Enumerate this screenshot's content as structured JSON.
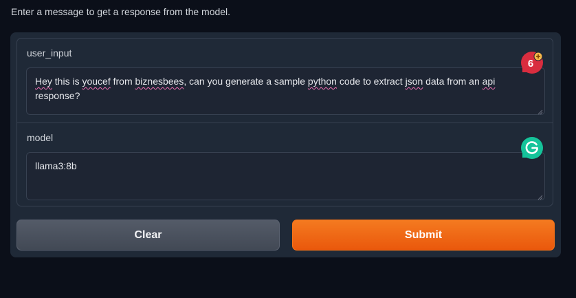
{
  "description": "Enter a message to get a response from the model.",
  "fields": {
    "user_input": {
      "label": "user_input",
      "value_parts": [
        {
          "text": "Hey",
          "spell": true
        },
        {
          "text": " this is ",
          "spell": false
        },
        {
          "text": "youcef",
          "spell": true
        },
        {
          "text": " from ",
          "spell": false
        },
        {
          "text": "biznesbees",
          "spell": true
        },
        {
          "text": ", can you generate a sample ",
          "spell": false
        },
        {
          "text": "python",
          "spell": true
        },
        {
          "text": " code to extract ",
          "spell": false
        },
        {
          "text": "json",
          "spell": true
        },
        {
          "text": " data from an ",
          "spell": false
        },
        {
          "text": "api",
          "spell": true
        },
        {
          "text": " response?",
          "spell": false
        }
      ],
      "grammarly_count": "6",
      "grammarly_color": "#d92d3f"
    },
    "model": {
      "label": "model",
      "value": "llama3:8b",
      "grammarly_color": "#15c39a"
    }
  },
  "buttons": {
    "clear_label": "Clear",
    "submit_label": "Submit"
  },
  "colors": {
    "background": "#0b0f19",
    "panel": "#1f2937",
    "accent": "#f97316",
    "spellcheck": "#f472b6"
  }
}
